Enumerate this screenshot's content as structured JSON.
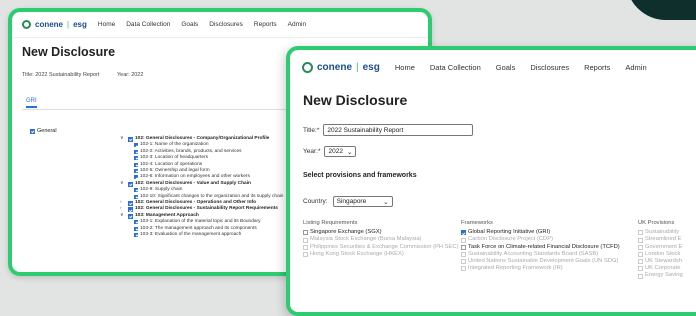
{
  "nav": {
    "logo_a": "conene",
    "logo_b": "esg",
    "items": [
      "Home",
      "Data Collection",
      "Goals",
      "Disclosures",
      "Reports",
      "Admin"
    ]
  },
  "back": {
    "title": "New Disclosure",
    "title_label": "Title:",
    "title_value": "2022 Sustainability Report",
    "year_label": "Year:",
    "year_value": "2022",
    "tab": "GRI",
    "general_label": "General",
    "groups": [
      {
        "caret": "∨",
        "checked": true,
        "title": "102: General Disclosures - Company/Organizational Profile",
        "items": [
          "102-1: Name of the organization",
          "102-2: Activities, brands, products, and services",
          "102-3: Location of headquarters",
          "102-4: Location of operations",
          "102-5: Ownership and legal form",
          "102-6: Information on employees and other workers"
        ]
      },
      {
        "caret": "∨",
        "checked": true,
        "title": "102: General Disclosures - Value and Supply Chain",
        "items": [
          "102-9: Supply chain",
          "102-10: Significant changes to the organization and its supply chain"
        ]
      },
      {
        "caret": "›",
        "checked": true,
        "title": "102: General Disclosures - Operations and Other Info",
        "items": []
      },
      {
        "caret": "›",
        "checked": true,
        "title": "102: General Disclosures - Sustainability Report Requirements",
        "items": []
      },
      {
        "caret": "∨",
        "checked": true,
        "title": "103: Management Approach",
        "items": [
          "103-1: Explanation of the material topic and its Boundary",
          "103-2: The management approach and its components",
          "103-3: Evaluation of the management approach"
        ]
      }
    ]
  },
  "front": {
    "title": "New Disclosure",
    "title_label": "Title:*",
    "title_value": "2022 Sustainability Report",
    "year_label": "Year:*",
    "year_value": "2022",
    "section": "Select provisions and frameworks",
    "country_label": "Country:",
    "country_value": "Singapore",
    "columns": [
      {
        "heading": "Listing Requirements",
        "rows": [
          {
            "label": "Singapore Exchange (SGX)",
            "checked": false,
            "disabled": false
          },
          {
            "label": "Malaysia Stock Exchange (Bursa Malaysia)",
            "checked": false,
            "disabled": true
          },
          {
            "label": "Philippines Securities & Exchange Commission (PH SEC)",
            "checked": false,
            "disabled": true
          },
          {
            "label": "Hong Kong Stock Exchange (HKEX)",
            "checked": false,
            "disabled": true
          }
        ]
      },
      {
        "heading": "Frameworks",
        "rows": [
          {
            "label": "Global Reporting Initiative (GRI)",
            "checked": true,
            "disabled": false
          },
          {
            "label": "Carbon Disclosure Project (CDP)",
            "checked": false,
            "disabled": true
          },
          {
            "label": "Task Force on Climate-related Financial Disclosure (TCFD)",
            "checked": false,
            "disabled": false
          },
          {
            "label": "Sustainability Accounting Standards Board (SASB)",
            "checked": false,
            "disabled": true
          },
          {
            "label": "United Nations Sustainable Development Goals (UN SDG)",
            "checked": false,
            "disabled": true
          },
          {
            "label": "Integrated Reporting Framework (IR)",
            "checked": false,
            "disabled": true
          }
        ]
      },
      {
        "heading": "UK Provisions",
        "rows": [
          {
            "label": "Sustainability",
            "checked": false,
            "disabled": true
          },
          {
            "label": "Streamlined E",
            "checked": false,
            "disabled": true
          },
          {
            "label": "Government E",
            "checked": false,
            "disabled": true
          },
          {
            "label": "London Stock",
            "checked": false,
            "disabled": true
          },
          {
            "label": "UK Stewardsh",
            "checked": false,
            "disabled": true
          },
          {
            "label": "UK Corporate",
            "checked": false,
            "disabled": true
          },
          {
            "label": "Energy Saving",
            "checked": false,
            "disabled": true
          }
        ]
      }
    ]
  },
  "colors": {
    "accent_green": "#2ecc71",
    "brand_blue": "#1b4f8f",
    "checkbox_blue": "#2a6fd1"
  }
}
